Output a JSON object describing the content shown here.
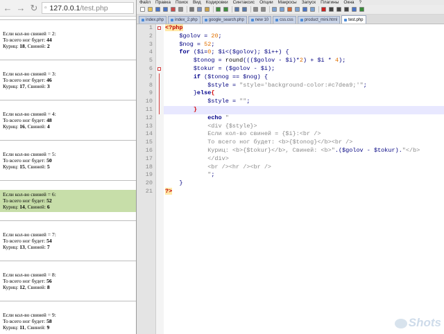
{
  "browser": {
    "url_host": "127.0.0.1",
    "url_path": "/test.php",
    "blocks": [
      {
        "line1": "Если кол-во свиней = 2:",
        "line2_prefix": "То всего ног будет: ",
        "legs": "44",
        "line3_prefix": "Куриц: ",
        "chickens": "18",
        "line3_mid": ", Свиней: ",
        "pigs": "2",
        "highlight": false
      },
      {
        "line1": "Если кол-во свиней = 3:",
        "line2_prefix": "То всего ног будет: ",
        "legs": "46",
        "line3_prefix": "Куриц: ",
        "chickens": "17",
        "line3_mid": ", Свиней: ",
        "pigs": "3",
        "highlight": false
      },
      {
        "line1": "Если кол-во свиней = 4:",
        "line2_prefix": "То всего ног будет: ",
        "legs": "48",
        "line3_prefix": "Куриц: ",
        "chickens": "16",
        "line3_mid": ", Свиней: ",
        "pigs": "4",
        "highlight": false
      },
      {
        "line1": "Если кол-во свиней = 5:",
        "line2_prefix": "То всего ног будет: ",
        "legs": "50",
        "line3_prefix": "Куриц: ",
        "chickens": "15",
        "line3_mid": ", Свиней: ",
        "pigs": "5",
        "highlight": false
      },
      {
        "line1": "Если кол-во свиней = 6:",
        "line2_prefix": "То всего ног будет: ",
        "legs": "52",
        "line3_prefix": "Куриц: ",
        "chickens": "14",
        "line3_mid": ", Свиней: ",
        "pigs": "6",
        "highlight": true
      },
      {
        "line1": "Если кол-во свиней = 7:",
        "line2_prefix": "То всего ног будет: ",
        "legs": "54",
        "line3_prefix": "Куриц: ",
        "chickens": "13",
        "line3_mid": ", Свиней: ",
        "pigs": "7",
        "highlight": false
      },
      {
        "line1": "Если кол-во свиней = 8:",
        "line2_prefix": "То всего ног будет: ",
        "legs": "56",
        "line3_prefix": "Куриц: ",
        "chickens": "12",
        "line3_mid": ", Свиней: ",
        "pigs": "8",
        "highlight": false
      },
      {
        "line1": "Если кол-во свиней = 9:",
        "line2_prefix": "То всего ног будет: ",
        "legs": "58",
        "line3_prefix": "Куриц: ",
        "chickens": "11",
        "line3_mid": ", Свиней: ",
        "pigs": "9",
        "highlight": false
      }
    ],
    "highlight_color": "#c7dea9"
  },
  "editor": {
    "menu": [
      "Файл",
      "Правка",
      "Поиск",
      "Вид",
      "Кодировки",
      "Синтаксис",
      "Опции",
      "Макросы",
      "Запуск",
      "Плагины",
      "Окна",
      "?"
    ],
    "tabs": [
      {
        "label": "index.php",
        "active": false
      },
      {
        "label": "index_2.php",
        "active": false
      },
      {
        "label": "google_search.php",
        "active": false
      },
      {
        "label": "new 10",
        "active": false
      },
      {
        "label": "css.css",
        "active": false
      },
      {
        "label": "product_mini.html",
        "active": false
      },
      {
        "label": "test.php",
        "active": true
      }
    ],
    "line_numbers": [
      "1",
      "2",
      "3",
      "4",
      "5",
      "6",
      "7",
      "8",
      "9",
      "10",
      "11",
      "12",
      "13",
      "14",
      "15",
      "16",
      "17",
      "18",
      "19",
      "20",
      "21"
    ],
    "current_line": 11
  },
  "watermark": "Shots",
  "colors": {
    "keyword": "#00008b",
    "number": "#e07000",
    "string": "#8a8a8a",
    "php_tag": "#c00000",
    "gutter": "#e4e4e4"
  }
}
